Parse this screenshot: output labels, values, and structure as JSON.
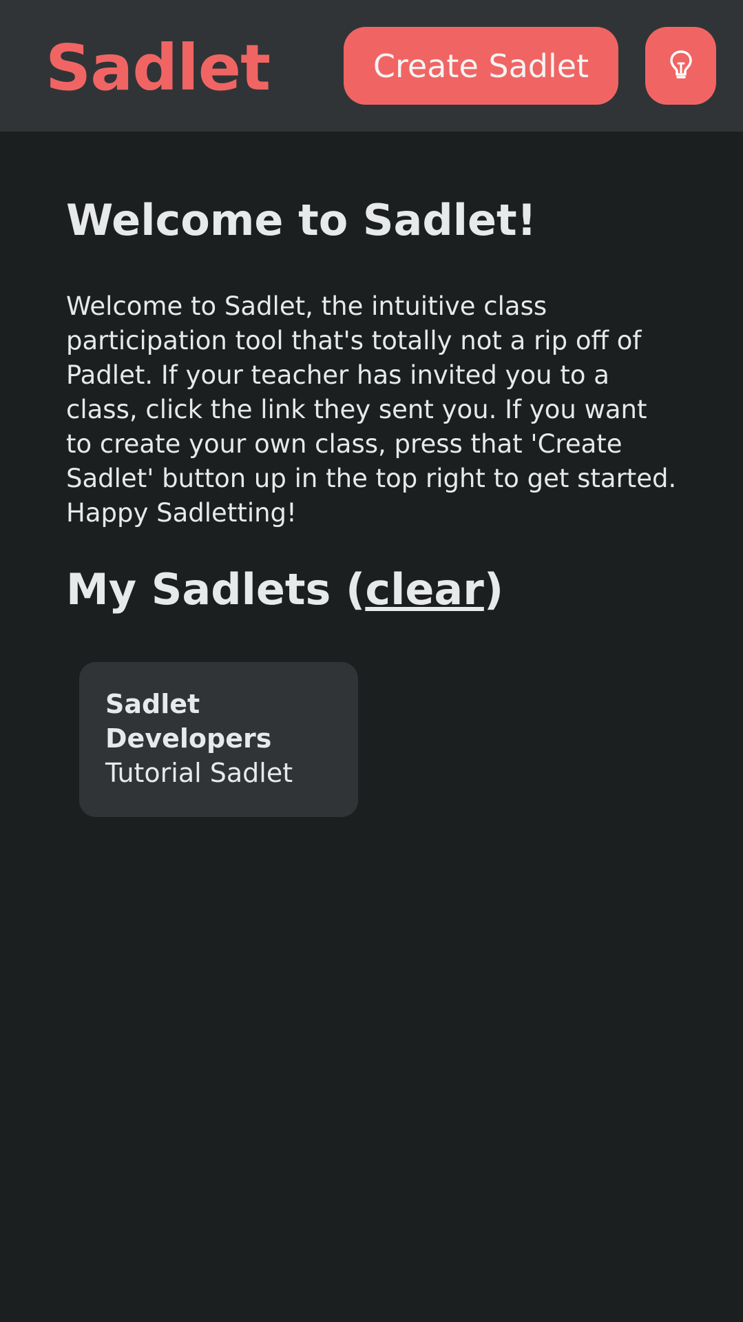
{
  "header": {
    "logo": "Sadlet",
    "create_button_label": "Create Sadlet",
    "idea_button_icon": "lightbulb-icon"
  },
  "main": {
    "welcome_title": "Welcome to Sadlet!",
    "welcome_text": "Welcome to Sadlet, the intuitive class participation tool that's totally not a rip off of Padlet. If your teacher has invited you to a class, click the link they sent you. If you want to create your own class, press that 'Create Sadlet' button up in the top right to get started. Happy Sadletting!",
    "my_sadlets_prefix": "My Sadlets (",
    "clear_link": "clear",
    "my_sadlets_suffix": ")"
  },
  "sadlets": [
    {
      "title": "Sadlet Developers",
      "subtitle": "Tutorial Sadlet"
    }
  ],
  "colors": {
    "accent": "#f06563",
    "header_bg": "#303437",
    "page_bg": "#1c1f20",
    "card_bg": "#303437",
    "text": "#e8e9ea"
  }
}
